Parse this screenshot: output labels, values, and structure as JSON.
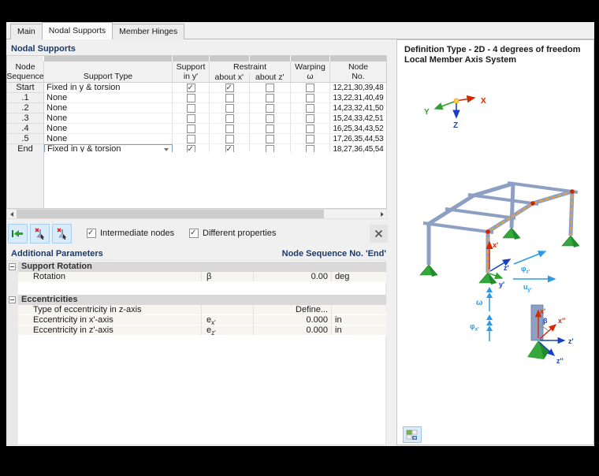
{
  "tabs": {
    "main": "Main",
    "nodal_supports": "Nodal Supports",
    "member_hinges": "Member Hinges"
  },
  "left": {
    "section_title": "Nodal Supports",
    "table": {
      "headers": {
        "node_seq_1": "Node",
        "node_seq_2": "Sequence",
        "support_type": "Support Type",
        "support_1": "Support",
        "support_2": "in y'",
        "restraint": "Restraint",
        "about_x": "about x'",
        "about_z": "about z'",
        "warping_1": "Warping",
        "warping_2": "ω",
        "node_no_1": "Node",
        "node_no_2": "No."
      },
      "rows": [
        {
          "seq": "Start",
          "type": "Fixed in y & torsion",
          "checks": [
            true,
            true,
            false,
            false
          ],
          "nodes": "12,21,30,39,48"
        },
        {
          "seq": ".1",
          "type": "None",
          "checks": [
            false,
            false,
            false,
            false
          ],
          "nodes": "13,22,31,40,49"
        },
        {
          "seq": ".2",
          "type": "None",
          "checks": [
            false,
            false,
            false,
            false
          ],
          "nodes": "14,23,32,41,50"
        },
        {
          "seq": ".3",
          "type": "None",
          "checks": [
            false,
            false,
            false,
            false
          ],
          "nodes": "15,24,33,42,51"
        },
        {
          "seq": ".4",
          "type": "None",
          "checks": [
            false,
            false,
            false,
            false
          ],
          "nodes": "16,25,34,43,52"
        },
        {
          "seq": ".5",
          "type": "None",
          "checks": [
            false,
            false,
            false,
            false
          ],
          "nodes": "17,26,35,44,53"
        },
        {
          "seq": "End",
          "type": "Fixed in y & torsion",
          "checks": [
            true,
            true,
            false,
            false
          ],
          "nodes": "18,27,36,45,54"
        }
      ]
    },
    "toolbar": {
      "intermediate_nodes": "Intermediate nodes",
      "different_properties": "Different properties"
    },
    "additional": {
      "title": "Additional Parameters",
      "context": "Node Sequence No. 'End'",
      "group1": "Support Rotation",
      "rotation": {
        "label": "Rotation",
        "symbol": "β",
        "value": "0.00",
        "unit": "deg"
      },
      "group2": "Eccentricities",
      "ecc_type": {
        "label": "Type of eccentricity in z-axis",
        "value": "Define..."
      },
      "ecc_x": {
        "label": "Eccentricity in x'-axis",
        "symbol_base": "e",
        "symbol_sub": "x'",
        "value": "0.000",
        "unit": "in"
      },
      "ecc_z": {
        "label": "Eccentricity in z'-axis",
        "symbol_base": "e",
        "symbol_sub": "z'",
        "value": "0.000",
        "unit": "in"
      }
    }
  },
  "preview": {
    "title_line1": "Definition Type - 2D - 4 degrees of freedom",
    "title_line2": "Local Member Axis System",
    "triad": {
      "x": "X",
      "y": "Y",
      "z": "Z"
    },
    "ann": {
      "x1": "x'",
      "z1": "z'",
      "y1": "y'",
      "phi": "φ",
      "z_sub": "z'",
      "x_sub": "x'",
      "u": "u",
      "u_sub": "y'",
      "omega": "ω",
      "beta": "β",
      "x2": "x''",
      "z2": "z''"
    }
  },
  "colors": {
    "accent_navy": "#1b3a6b",
    "support_green": "#2fa12f",
    "highlight_orange": "#f0a030",
    "axis_red": "#d42a00",
    "axis_blue": "#1a3fc4",
    "axis_lightblue": "#2b9ae8",
    "steel_blue": "#8d9fc3"
  }
}
